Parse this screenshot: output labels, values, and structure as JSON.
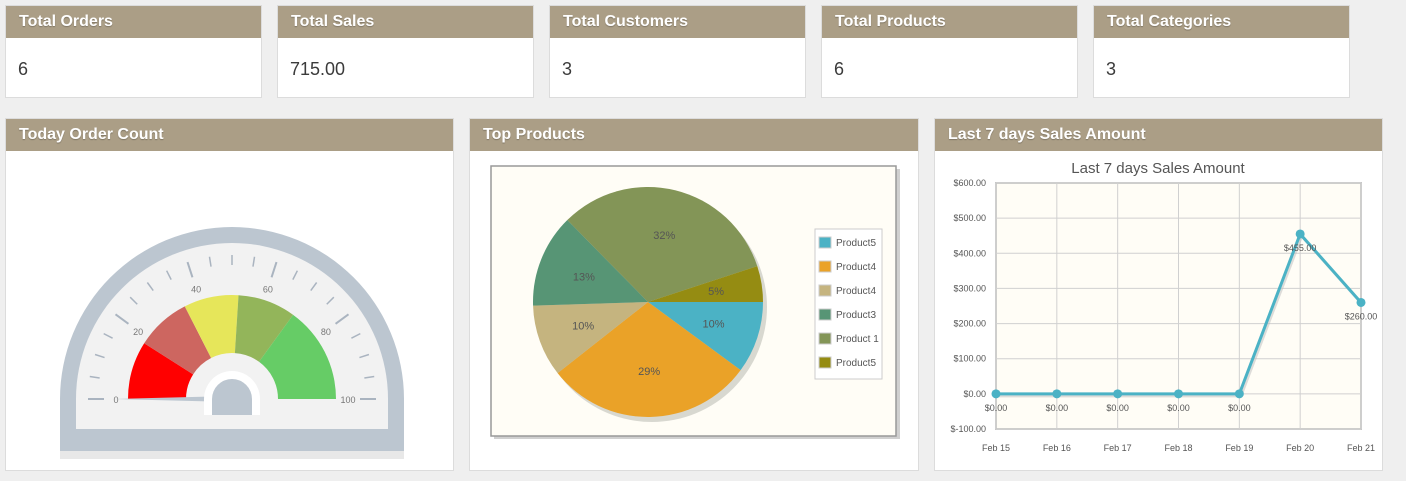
{
  "stats": [
    {
      "title": "Total Orders",
      "value": "6"
    },
    {
      "title": "Total Sales",
      "value": "715.00"
    },
    {
      "title": "Total Customers",
      "value": "3"
    },
    {
      "title": "Total Products",
      "value": "6"
    },
    {
      "title": "Total Categories",
      "value": "3"
    }
  ],
  "panels": {
    "gauge_title": "Today Order Count",
    "pie_title": "Top Products",
    "line_title": "Last 7 days Sales Amount"
  },
  "chart_data": [
    {
      "type": "gauge",
      "min": 0,
      "max": 100,
      "value": 0,
      "tick_labels": [
        "0",
        "20",
        "40",
        "60",
        "80",
        "100"
      ],
      "bands": [
        {
          "from": 0,
          "to": 18,
          "color": "#ff0000"
        },
        {
          "from": 18,
          "to": 35,
          "color": "#cd6660"
        },
        {
          "from": 35,
          "to": 52,
          "color": "#e6e65a"
        },
        {
          "from": 52,
          "to": 70,
          "color": "#93b55a"
        },
        {
          "from": 70,
          "to": 100,
          "color": "#66cc66"
        }
      ]
    },
    {
      "type": "pie",
      "slices": [
        {
          "label": "Product5",
          "value": 10,
          "pct_label": "10%",
          "color": "#4bb2c5"
        },
        {
          "label": "Product4",
          "value": 29,
          "pct_label": "29%",
          "color": "#eaa228"
        },
        {
          "label": "Product4",
          "value": 10,
          "pct_label": "10%",
          "color": "#c5b47f"
        },
        {
          "label": "Product3",
          "value": 13,
          "pct_label": "13%",
          "color": "#579575"
        },
        {
          "label": "Product 1",
          "value": 32,
          "pct_label": "32%",
          "color": "#839557"
        },
        {
          "label": "Product5",
          "value": 5,
          "pct_label": "5%",
          "color": "#958c12"
        }
      ]
    },
    {
      "type": "line",
      "title": "Last 7 days Sales Amount",
      "x": [
        "Feb 15",
        "Feb 16",
        "Feb 17",
        "Feb 18",
        "Feb 19",
        "Feb 20",
        "Feb 21"
      ],
      "series": [
        {
          "values": [
            0,
            0,
            0,
            0,
            0,
            455,
            260
          ],
          "point_labels": [
            "$0.00",
            "$0.00",
            "$0.00",
            "$0.00",
            "$0.00",
            "$455.00",
            "$260.00"
          ],
          "color": "#4bb2c5"
        }
      ],
      "ylim": [
        -100,
        600
      ],
      "y_ticks": [
        {
          "value": 600,
          "label": "$600.00"
        },
        {
          "value": 500,
          "label": "$500.00"
        },
        {
          "value": 400,
          "label": "$400.00"
        },
        {
          "value": 300,
          "label": "$300.00"
        },
        {
          "value": 200,
          "label": "$200.00"
        },
        {
          "value": 100,
          "label": "$100.00"
        },
        {
          "value": 0,
          "label": "$0.00"
        },
        {
          "value": -100,
          "label": "$-100.00"
        }
      ],
      "grid": true
    }
  ]
}
